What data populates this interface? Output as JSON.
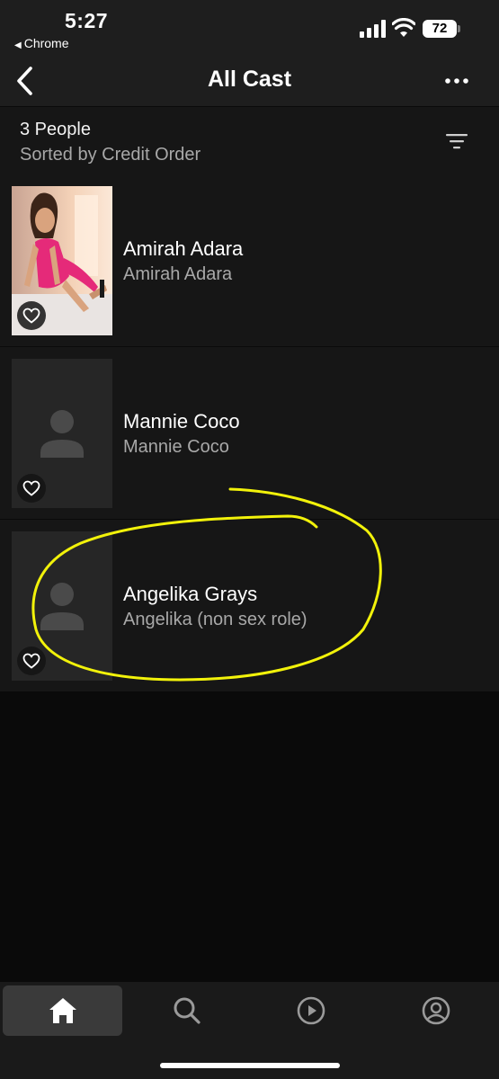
{
  "status_bar": {
    "time": "5:27",
    "back_app": "Chrome",
    "battery": "72"
  },
  "nav": {
    "title": "All Cast"
  },
  "summary": {
    "count": "3 People",
    "sort": "Sorted by Credit Order"
  },
  "cast": [
    {
      "name": "Amirah Adara",
      "role": "Amirah Adara",
      "has_photo": true
    },
    {
      "name": "Mannie Coco",
      "role": "Mannie Coco",
      "has_photo": false
    },
    {
      "name": "Angelika Grays",
      "role": "Angelika (non sex role)",
      "has_photo": false
    }
  ],
  "tabs": [
    {
      "icon": "home-icon",
      "active": true
    },
    {
      "icon": "search-icon",
      "active": false
    },
    {
      "icon": "play-icon",
      "active": false
    },
    {
      "icon": "profile-icon",
      "active": false
    }
  ],
  "colors": {
    "background": "#0a0a0a",
    "bar": "#1e1e1e",
    "row": "#161616",
    "secondary_text": "#a8a8a8",
    "annotation": "#f2f20a"
  }
}
